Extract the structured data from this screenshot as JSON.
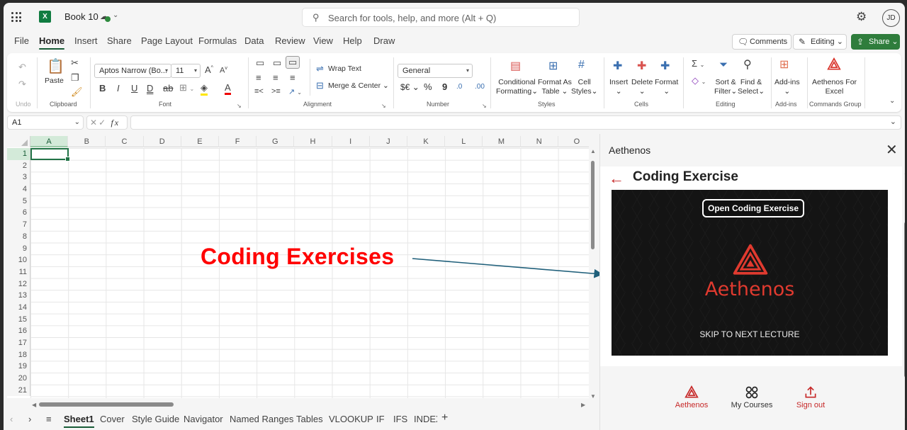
{
  "app": {
    "doc_title": "Book 10",
    "search_placeholder": "Search for tools, help, and more (Alt + Q)",
    "avatar_initials": "JD"
  },
  "menu_tabs": [
    "File",
    "Home",
    "Insert",
    "Share",
    "Page Layout",
    "Formulas",
    "Data",
    "Review",
    "View",
    "Help",
    "Draw"
  ],
  "active_menu_tab": "Home",
  "header_buttons": {
    "comments": "Comments",
    "editing": "Editing",
    "share": "Share"
  },
  "ribbon": {
    "undo_label": "Undo",
    "clipboard": {
      "paste": "Paste",
      "group": "Clipboard"
    },
    "font": {
      "name": "Aptos Narrow (Bo...",
      "size": "11",
      "group": "Font"
    },
    "alignment": {
      "wrap": "Wrap Text",
      "merge": "Merge & Center",
      "group": "Alignment"
    },
    "number": {
      "format": "General",
      "currency": "$€",
      "percent": "%",
      "comma": "9",
      "group": "Number"
    },
    "styles": {
      "conditional": [
        "Conditional",
        "Formatting"
      ],
      "format_table": [
        "Format As",
        "Table"
      ],
      "cell_styles": [
        "Cell",
        "Styles"
      ],
      "group": "Styles"
    },
    "cells": {
      "insert": "Insert",
      "delete": "Delete",
      "format": "Format",
      "group": "Cells"
    },
    "editing": {
      "sort": [
        "Sort &",
        "Filter"
      ],
      "find": [
        "Find &",
        "Select"
      ],
      "group": "Editing"
    },
    "addins": {
      "label": "Add-ins",
      "group": "Add-ins"
    },
    "commands": {
      "label": [
        "Aethenos For",
        "Excel"
      ],
      "group": "Commands Group"
    }
  },
  "formula_bar": {
    "name_box": "A1",
    "formula": ""
  },
  "grid": {
    "columns": [
      "A",
      "B",
      "C",
      "D",
      "E",
      "F",
      "G",
      "H",
      "I",
      "J",
      "K",
      "L",
      "M",
      "N",
      "O"
    ],
    "rows": [
      "1",
      "2",
      "3",
      "4",
      "5",
      "6",
      "7",
      "8",
      "9",
      "10",
      "11",
      "12",
      "13",
      "14",
      "15",
      "16",
      "17",
      "18",
      "19",
      "20",
      "21"
    ],
    "selected_cell": "A1"
  },
  "annotation": "Coding Exercises",
  "sheet_tabs": [
    "Sheet1",
    "Cover",
    "Style Guide",
    "Navigator",
    "Named Ranges",
    "Tables",
    "VLOOKUP",
    "IF",
    "IFS",
    "INDEX"
  ],
  "active_sheet": "Sheet1",
  "pane": {
    "title": "Aethenos",
    "heading": "Coding Exercise",
    "open_button": "Open Coding Exercise",
    "brand": "Aethenos",
    "skip": "SKIP TO NEXT LECTURE",
    "nav": [
      {
        "label": "Aethenos",
        "icon": "aethenos-logo-icon"
      },
      {
        "label": "My Courses",
        "icon": "grid-icon"
      },
      {
        "label": "Sign out",
        "icon": "sign-out-icon"
      }
    ],
    "accent": "#c62828"
  }
}
